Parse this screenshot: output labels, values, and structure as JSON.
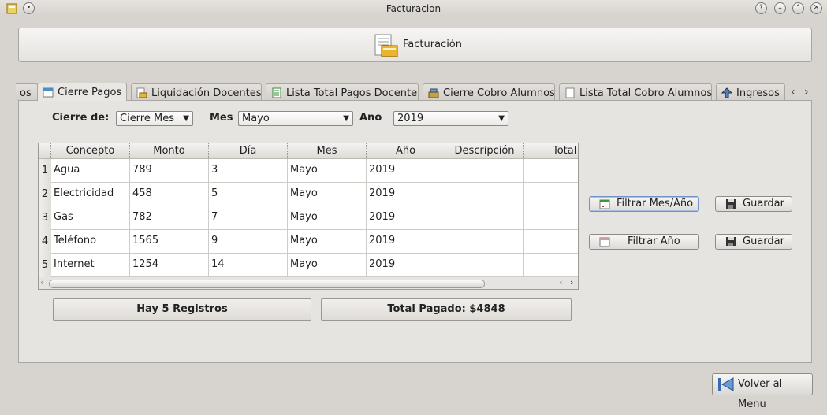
{
  "window": {
    "title": "Facturacion"
  },
  "header": {
    "title": "Facturación"
  },
  "tabs": [
    {
      "label": "os"
    },
    {
      "label": "Cierre Pagos"
    },
    {
      "label": "Liquidación Docentes"
    },
    {
      "label": "Lista Total Pagos Docente"
    },
    {
      "label": "Cierre Cobro Alumnos"
    },
    {
      "label": "Lista Total Cobro Alumnos"
    },
    {
      "label": "Ingresos"
    }
  ],
  "filters": {
    "cierre_label": "Cierre de:",
    "cierre_value": "Cierre Mes",
    "mes_label": "Mes",
    "mes_value": "Mayo",
    "anio_label": "Año",
    "anio_value": "2019"
  },
  "table": {
    "columns": [
      "Concepto",
      "Monto",
      "Día",
      "Mes",
      "Año",
      "Descripción",
      "Total"
    ],
    "rows": [
      {
        "n": "1",
        "concepto": "Agua",
        "monto": "789",
        "dia": "3",
        "mes": "Mayo",
        "anio": "2019"
      },
      {
        "n": "2",
        "concepto": "Electricidad",
        "monto": "458",
        "dia": "5",
        "mes": "Mayo",
        "anio": "2019"
      },
      {
        "n": "3",
        "concepto": "Gas",
        "monto": "782",
        "dia": "7",
        "mes": "Mayo",
        "anio": "2019"
      },
      {
        "n": "4",
        "concepto": "Teléfono",
        "monto": "1565",
        "dia": "9",
        "mes": "Mayo",
        "anio": "2019"
      },
      {
        "n": "5",
        "concepto": "Internet",
        "monto": "1254",
        "dia": "14",
        "mes": "Mayo",
        "anio": "2019"
      }
    ]
  },
  "actions": {
    "filtrar_mes_anio": "Filtrar Mes/Año",
    "filtrar_anio": "Filtrar Año",
    "guardar": "Guardar"
  },
  "summary": {
    "registros": "Hay 5 Registros",
    "total": "Total Pagado: $4848"
  },
  "footer": {
    "back_label": "Volver al Menu"
  }
}
